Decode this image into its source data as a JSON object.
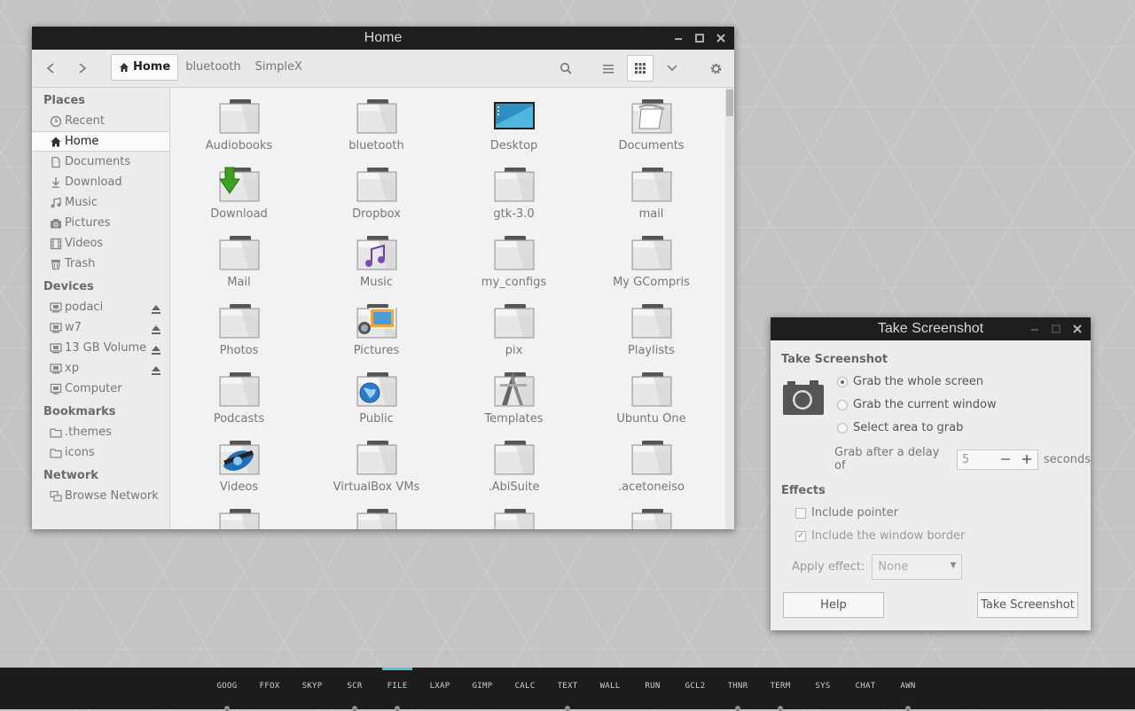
{
  "file_manager": {
    "title": "Home",
    "breadcrumbs": [
      "Home",
      "bluetooth",
      "SimpleX"
    ],
    "sidebar": {
      "places_heading": "Places",
      "places": [
        {
          "label": "Recent",
          "icon": "clock-icon"
        },
        {
          "label": "Home",
          "icon": "home-icon",
          "active": true
        },
        {
          "label": "Documents",
          "icon": "document-icon"
        },
        {
          "label": "Download",
          "icon": "download-icon"
        },
        {
          "label": "Music",
          "icon": "music-icon"
        },
        {
          "label": "Pictures",
          "icon": "camera-icon"
        },
        {
          "label": "Videos",
          "icon": "film-icon"
        },
        {
          "label": "Trash",
          "icon": "trash-icon"
        }
      ],
      "devices_heading": "Devices",
      "devices": [
        {
          "label": "podaci",
          "icon": "drive-icon",
          "eject": true
        },
        {
          "label": "w7",
          "icon": "drive-icon",
          "eject": true
        },
        {
          "label": "13 GB Volume",
          "icon": "drive-icon",
          "eject": true
        },
        {
          "label": "xp",
          "icon": "drive-icon",
          "eject": true
        },
        {
          "label": "Computer",
          "icon": "computer-icon",
          "eject": false
        }
      ],
      "bookmarks_heading": "Bookmarks",
      "bookmarks": [
        {
          "label": ".themes",
          "icon": "folder-icon"
        },
        {
          "label": "icons",
          "icon": "folder-icon"
        }
      ],
      "network_heading": "Network",
      "network": [
        {
          "label": "Browse Network",
          "icon": "network-icon"
        }
      ]
    },
    "files": [
      {
        "label": "Audiobooks",
        "icon": "folder"
      },
      {
        "label": "bluetooth",
        "icon": "folder"
      },
      {
        "label": "Desktop",
        "icon": "desktop"
      },
      {
        "label": "Documents",
        "icon": "documents"
      },
      {
        "label": "Download",
        "icon": "download"
      },
      {
        "label": "Dropbox",
        "icon": "folder"
      },
      {
        "label": "gtk-3.0",
        "icon": "folder"
      },
      {
        "label": "mail",
        "icon": "folder"
      },
      {
        "label": "Mail",
        "icon": "folder"
      },
      {
        "label": "Music",
        "icon": "music"
      },
      {
        "label": "my_configs",
        "icon": "folder"
      },
      {
        "label": "My GCompris",
        "icon": "folder"
      },
      {
        "label": "Photos",
        "icon": "folder"
      },
      {
        "label": "Pictures",
        "icon": "pictures"
      },
      {
        "label": "pix",
        "icon": "folder"
      },
      {
        "label": "Playlists",
        "icon": "folder"
      },
      {
        "label": "Podcasts",
        "icon": "folder"
      },
      {
        "label": "Public",
        "icon": "public"
      },
      {
        "label": "Templates",
        "icon": "templates"
      },
      {
        "label": "Ubuntu One",
        "icon": "folder"
      },
      {
        "label": "Videos",
        "icon": "videos"
      },
      {
        "label": "VirtualBox VMs",
        "icon": "folder"
      },
      {
        "label": ".AbiSuite",
        "icon": "folder"
      },
      {
        "label": ".acetoneiso",
        "icon": "folder"
      },
      {
        "label": "",
        "icon": "folder"
      },
      {
        "label": "",
        "icon": "folder"
      },
      {
        "label": "",
        "icon": "folder"
      },
      {
        "label": "",
        "icon": "folder"
      }
    ]
  },
  "screenshot_dialog": {
    "title": "Take Screenshot",
    "section_take": "Take Screenshot",
    "options": [
      "Grab the whole screen",
      "Grab the current window",
      "Select area to grab"
    ],
    "selected_option": 0,
    "delay_prefix": "Grab after a delay of",
    "delay_value": "5",
    "delay_suffix": "seconds",
    "section_effects": "Effects",
    "include_pointer": "Include pointer",
    "include_border": "Include the window border",
    "apply_effect_label": "Apply effect:",
    "apply_effect_value": "None",
    "help_button": "Help",
    "take_button": "Take Screenshot"
  },
  "taskbar": {
    "items": [
      {
        "label": "GOOG",
        "running": true
      },
      {
        "label": "FFOX",
        "running": false
      },
      {
        "label": "SKYP",
        "running": false
      },
      {
        "label": "SCR",
        "running": true
      },
      {
        "label": "FILE",
        "running": true,
        "active": true
      },
      {
        "label": "LXAP",
        "running": false
      },
      {
        "label": "GIMP",
        "running": false
      },
      {
        "label": "CALC",
        "running": false
      },
      {
        "label": "TEXT",
        "running": true
      },
      {
        "label": "WALL",
        "running": false
      },
      {
        "label": "RUN",
        "running": false
      },
      {
        "label": "GCL2",
        "running": false
      },
      {
        "label": "THNR",
        "running": true
      },
      {
        "label": "TERM",
        "running": true
      },
      {
        "label": "SYS",
        "running": false
      },
      {
        "label": "CHAT",
        "running": false
      },
      {
        "label": "AWN",
        "running": true
      }
    ],
    "accent": "#4ec4d6"
  }
}
